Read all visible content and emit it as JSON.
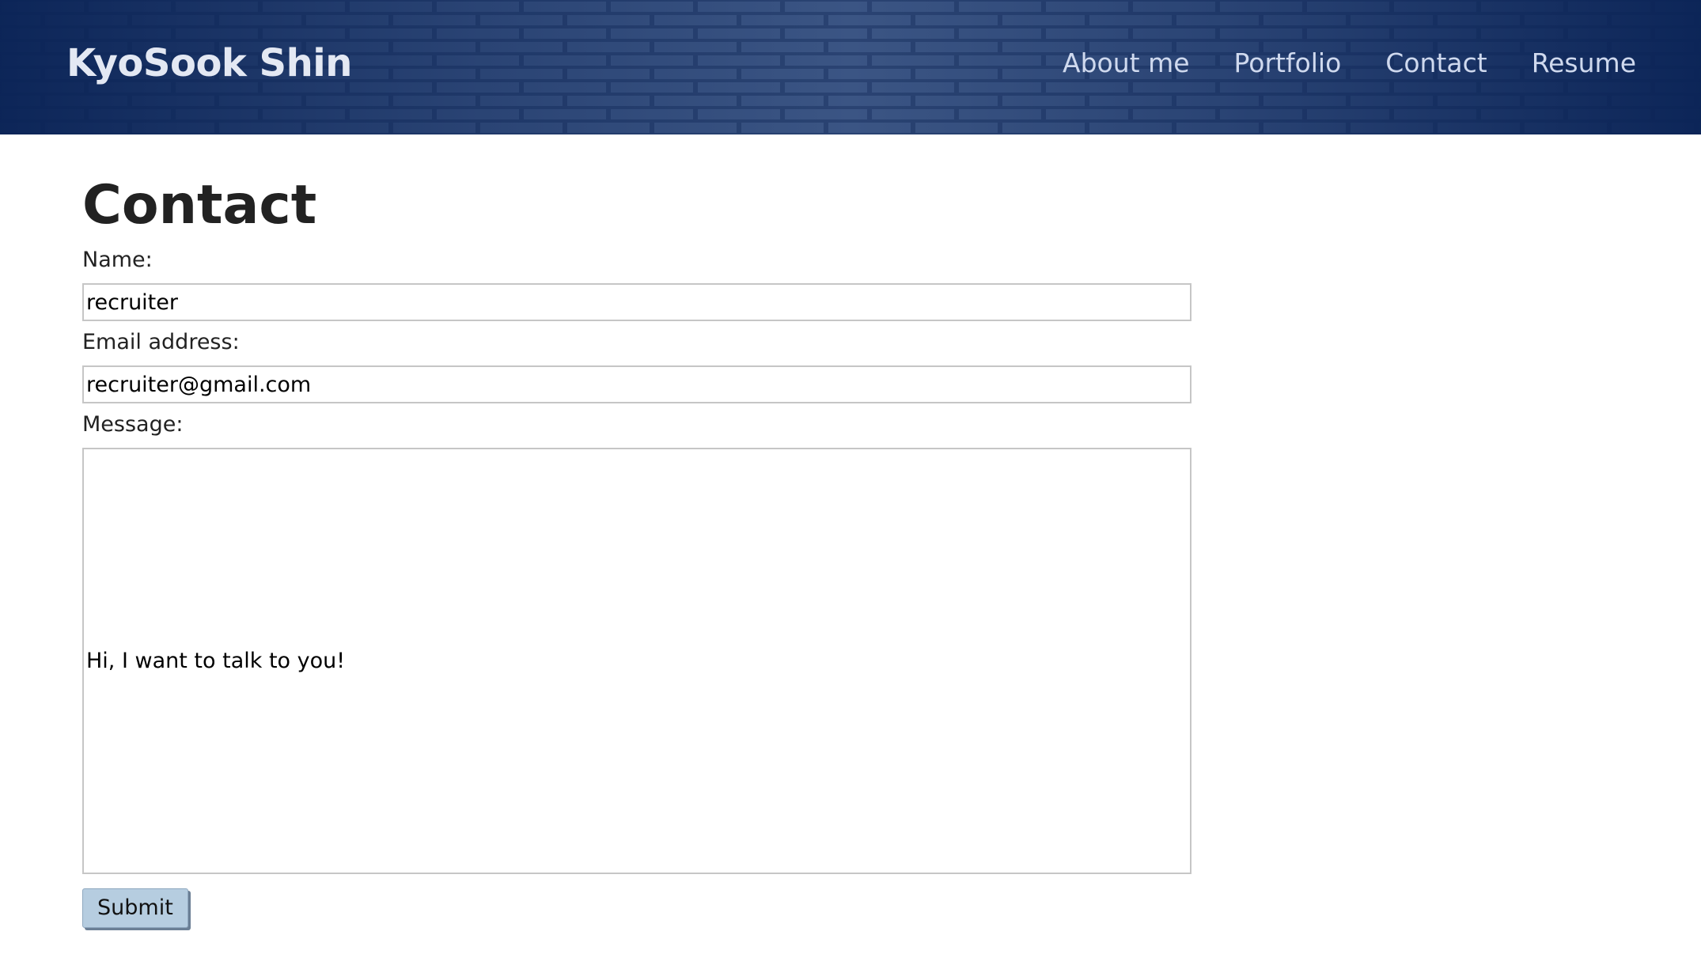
{
  "header": {
    "brand": "KyoSook Shin",
    "nav": [
      {
        "label": "About me"
      },
      {
        "label": "Portfolio"
      },
      {
        "label": "Contact"
      },
      {
        "label": "Resume"
      }
    ],
    "colors": {
      "bar": "#0f2a5c",
      "brick_light": "#a9a6b8",
      "nav_text": "#cfd9ee"
    }
  },
  "contact": {
    "title": "Contact",
    "name_label": "Name:",
    "name_value": "recruiter",
    "email_label": "Email address:",
    "email_value": "recruiter@gmail.com",
    "message_label": "Message:",
    "message_value": "Hi, I want to talk to you!",
    "submit_label": "Submit",
    "button_color": "#b6cde0"
  }
}
